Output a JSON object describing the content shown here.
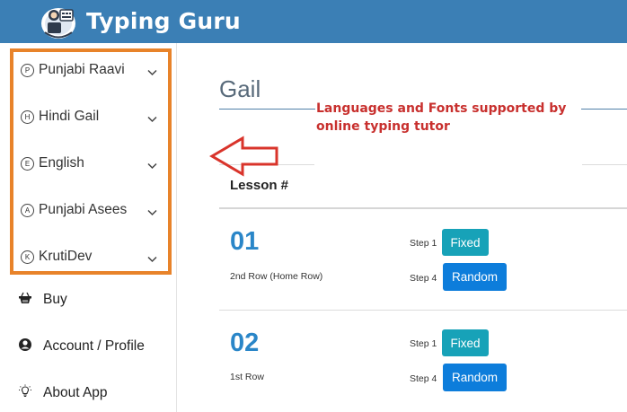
{
  "app": {
    "title": "Typing Guru"
  },
  "languages": [
    {
      "letter": "P",
      "label": "Punjabi Raavi"
    },
    {
      "letter": "H",
      "label": "Hindi Gail"
    },
    {
      "letter": "E",
      "label": "English"
    },
    {
      "letter": "A",
      "label": "Punjabi Asees"
    },
    {
      "letter": "K",
      "label": "KrutiDev"
    }
  ],
  "menu": [
    {
      "icon": "basket-icon",
      "label": "Buy"
    },
    {
      "icon": "user-circle-icon",
      "label": "Account / Profile"
    },
    {
      "icon": "lightbulb-icon",
      "label": "About App"
    }
  ],
  "main": {
    "title": "Gail",
    "lesson_header": "Lesson #",
    "annotation": "Languages and Fonts supported by online typing tutor",
    "lessons": [
      {
        "number": "01",
        "name": "2nd Row (Home Row)",
        "step1": "Step 1",
        "step1_button": "Fixed",
        "step4": "Step 4",
        "step4_button": "Random"
      },
      {
        "number": "02",
        "name": "1st Row",
        "step1": "Step 1",
        "step1_button": "Fixed",
        "step4": "Step 4",
        "step4_button": "Random"
      }
    ]
  },
  "colors": {
    "header": "#3b7fb5",
    "highlight_box": "#e8832a",
    "annotation_text": "#c8302e",
    "arrow": "#d9342b",
    "fixed_button": "#17a2b8",
    "random_button": "#0d7ddb",
    "lesson_number": "#2a86c8"
  }
}
